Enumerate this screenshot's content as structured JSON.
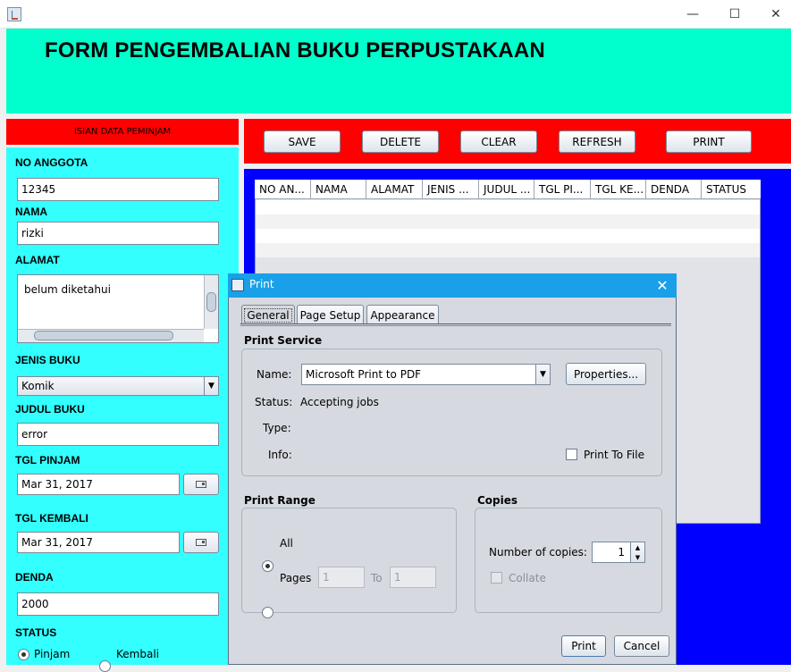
{
  "window": {
    "minimize_glyph": "—",
    "maximize_glyph": "☐",
    "close_glyph": "✕"
  },
  "header": {
    "title": "FORM PENGEMBALIAN BUKU PERPUSTAKAAN"
  },
  "form": {
    "panel_title": "ISIAN DATA PEMINJAM",
    "no_anggota_label": "NO ANGGOTA",
    "no_anggota_value": "12345",
    "nama_label": "NAMA",
    "nama_value": "rizki",
    "alamat_label": "ALAMAT",
    "alamat_value": "belum diketahui",
    "jenis_buku_label": "JENIS BUKU",
    "jenis_buku_value": "Komik",
    "judul_buku_label": "JUDUL BUKU",
    "judul_buku_value": "error",
    "tgl_pinjam_label": "TGL PINJAM",
    "tgl_pinjam_value": "Mar 31, 2017",
    "tgl_kembali_label": "TGL KEMBALI",
    "tgl_kembali_value": "Mar 31, 2017",
    "denda_label": "DENDA",
    "denda_value": "2000",
    "status_label": "STATUS",
    "status_options": [
      "Pinjam",
      "Kembali"
    ],
    "status_selected": "Pinjam"
  },
  "toolbar": {
    "save": "SAVE",
    "delete": "DELETE",
    "clear": "CLEAR",
    "refresh": "REFRESH",
    "print": "PRINT"
  },
  "table": {
    "columns": [
      "NO AN...",
      "NAMA",
      "ALAMAT",
      "JENIS ...",
      "JUDUL ...",
      "TGL PI...",
      "TGL KE...",
      "DENDA",
      "STATUS"
    ]
  },
  "print_dialog": {
    "title": "Print",
    "close_glyph": "✕",
    "tabs": [
      "General",
      "Page Setup",
      "Appearance"
    ],
    "active_tab": "General",
    "print_service_title": "Print Service",
    "name_label": "Name:",
    "printer_name": "Microsoft Print to PDF",
    "properties_button": "Properties...",
    "status_label": "Status:",
    "status_value": "Accepting jobs",
    "type_label": "Type:",
    "info_label": "Info:",
    "print_to_file_label": "Print To File",
    "print_range_title": "Print Range",
    "all_label": "All",
    "pages_label": "Pages",
    "pages_from": "1",
    "pages_to_label": "To",
    "pages_to": "1",
    "copies_title": "Copies",
    "number_of_copies_label": "Number of copies:",
    "copies_value": "1",
    "collate_label": "Collate",
    "print_button": "Print",
    "cancel_button": "Cancel"
  }
}
